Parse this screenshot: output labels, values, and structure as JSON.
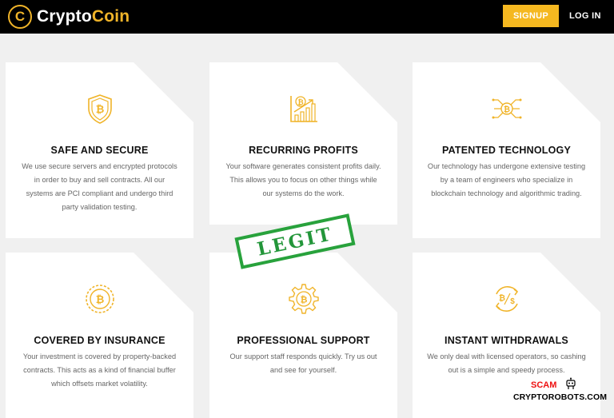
{
  "header": {
    "brand_letter": "C",
    "brand_part1": "Crypto",
    "brand_part2": "Coin",
    "signup_label": "SIGNUP",
    "login_label": "LOG IN"
  },
  "features": [
    {
      "icon": "bitcoin-shield-icon",
      "title": "SAFE AND SECURE",
      "text": "We use secure servers and encrypted protocols in order to buy and sell contracts. All our systems are PCI compliant and undergo third party validation testing."
    },
    {
      "icon": "bitcoin-growth-chart-icon",
      "title": "RECURRING PROFITS",
      "text": "Your software generates consistent profits daily. This allows you to focus on other things while our systems do the work."
    },
    {
      "icon": "bitcoin-circuit-icon",
      "title": "PATENTED TECHNOLOGY",
      "text": "Our technology has undergone extensive testing by a team of engineers who specialize in blockchain technology and algorithmic trading."
    },
    {
      "icon": "bitcoin-coin-icon",
      "title": "COVERED BY INSURANCE",
      "text": "Your investment is covered by property-backed contracts. This acts as a kind of financial buffer which offsets market volatility."
    },
    {
      "icon": "bitcoin-gear-icon",
      "title": "PROFESSIONAL SUPPORT",
      "text": "Our support staff responds quickly. Try us out and see for yourself."
    },
    {
      "icon": "bitcoin-dollar-exchange-icon",
      "title": "INSTANT WITHDRAWALS",
      "text": "We only deal with licensed operators, so cashing out is a simple and speedy process."
    }
  ],
  "stamp": {
    "label": "LEGIT"
  },
  "watermark": {
    "scam": "SCAM",
    "site": "CRYPTOROBOTS.COM"
  },
  "colors": {
    "accent": "#f0b429",
    "button": "#f5b820",
    "stamp": "#28a23c",
    "scam": "#e11111"
  }
}
